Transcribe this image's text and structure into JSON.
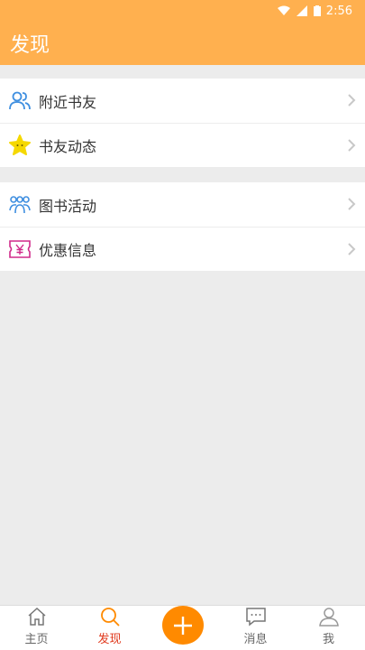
{
  "status_bar": {
    "time": "2:56"
  },
  "header": {
    "title": "发现"
  },
  "menu_groups": [
    {
      "items": [
        {
          "label": "附近书友",
          "icon": "users-icon",
          "icon_color": "#3f8fe0"
        },
        {
          "label": "书友动态",
          "icon": "star-face-icon",
          "icon_color": "#f5d800"
        }
      ]
    },
    {
      "items": [
        {
          "label": "图书活动",
          "icon": "group-icon",
          "icon_color": "#3f8fe0"
        },
        {
          "label": "优惠信息",
          "icon": "coupon-yen-icon",
          "icon_color": "#d02a8a"
        }
      ]
    }
  ],
  "tabs": [
    {
      "label": "主页",
      "icon": "home-icon",
      "active": false
    },
    {
      "label": "发现",
      "icon": "search-icon",
      "active": true
    },
    {
      "label": "",
      "icon": "plus-icon",
      "active": false
    },
    {
      "label": "消息",
      "icon": "message-icon",
      "active": false
    },
    {
      "label": "我",
      "icon": "user-icon",
      "active": false
    }
  ],
  "colors": {
    "accent": "#ffb04f",
    "fab": "#ff8a00",
    "active_tab": "#e03a1e",
    "background": "#ececec"
  }
}
